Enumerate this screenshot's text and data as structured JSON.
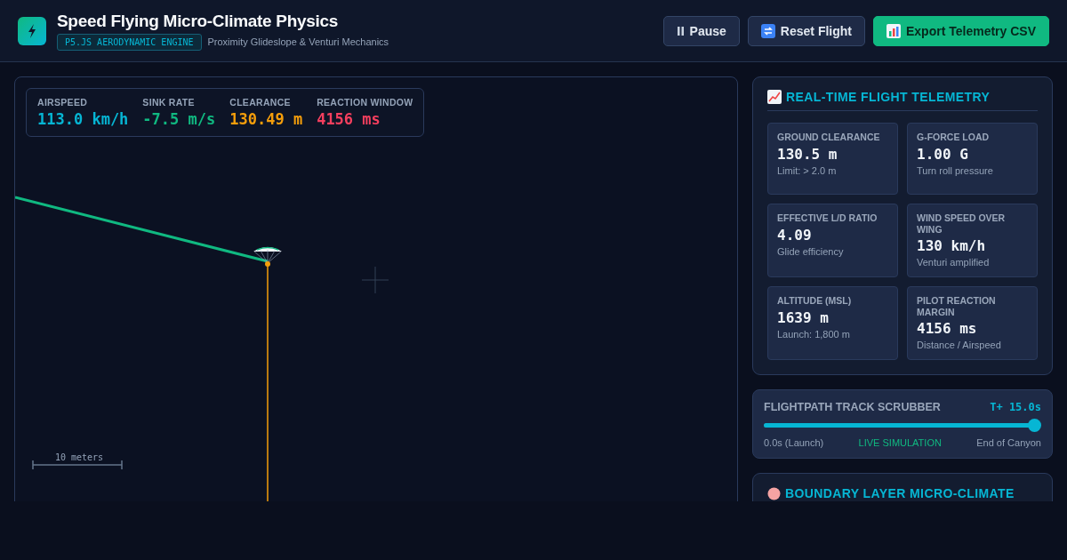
{
  "header": {
    "title": "Speed Flying Micro-Climate Physics",
    "badge": "P5.JS AERODYNAMIC ENGINE",
    "subtitle": "Proximity Glideslope & Venturi Mechanics"
  },
  "buttons": [
    {
      "label": "Pause",
      "kind": "pause"
    },
    {
      "label": "Reset Flight",
      "kind": "reset"
    },
    {
      "label": "Export Telemetry CSV",
      "kind": "export"
    }
  ],
  "hud": [
    {
      "label": "AIRSPEED",
      "value": "113.0 km/h",
      "color": "#06b6d4"
    },
    {
      "label": "SINK RATE",
      "value": "-7.5 m/s",
      "color": "#10b981"
    },
    {
      "label": "CLEARANCE",
      "value": "130.49 m",
      "color": "#f59e0b"
    },
    {
      "label": "REACTION WINDOW",
      "value": "4156 ms",
      "color": "#f43f5e"
    }
  ],
  "canvas": {
    "scale_label": "10 meters"
  },
  "telemetry": {
    "title": "REAL-TIME FLIGHT TELEMETRY",
    "cards": [
      {
        "label": "GROUND CLEARANCE",
        "value": "130.5 m",
        "note": "Limit: > 2.0 m"
      },
      {
        "label": "G-FORCE LOAD",
        "value": "1.00 G",
        "note": "Turn roll pressure"
      },
      {
        "label": "EFFECTIVE L/D RATIO",
        "value": "4.09",
        "note": "Glide efficiency"
      },
      {
        "label": "WIND SPEED OVER WING",
        "value": "130 km/h",
        "note": "Venturi amplified"
      },
      {
        "label": "ALTITUDE (MSL)",
        "value": "1639 m",
        "note": "Launch: 1,800 m"
      },
      {
        "label": "PILOT REACTION MARGIN",
        "value": "4156 ms",
        "note": "Distance / Airspeed"
      }
    ]
  },
  "scrubber": {
    "title": "FLIGHTPATH TRACK SCRUBBER",
    "time": "T+ 15.0s",
    "level": 1,
    "start": "0.0s (Launch)",
    "status": "LIVE SIMULATION",
    "end": "End of Canyon"
  },
  "microclimate": {
    "title": "BOUNDARY LAYER MICRO-CLIMATE"
  }
}
